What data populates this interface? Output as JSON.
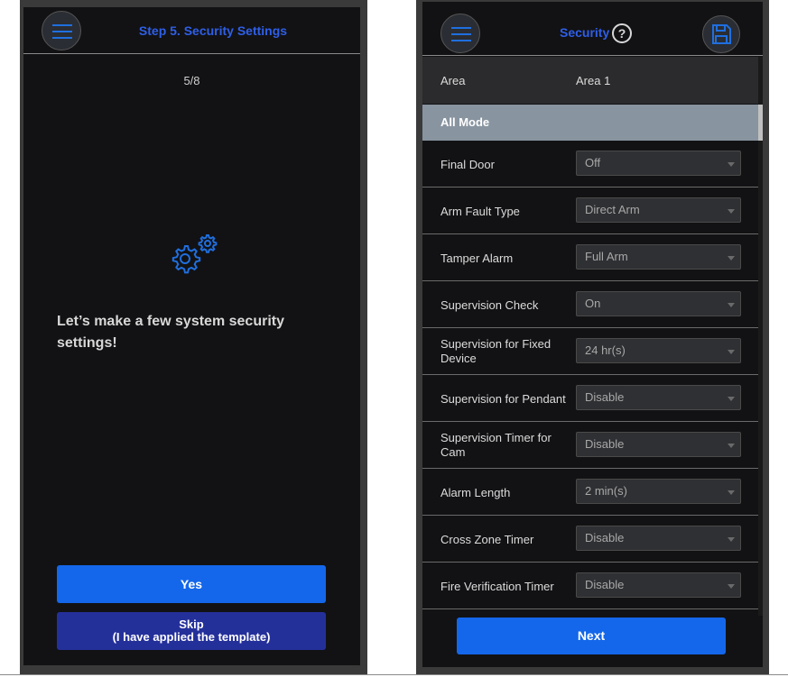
{
  "left": {
    "title": "Step 5. Security Settings",
    "step": "5/8",
    "intro": "Let’s make a few system security settings!",
    "yes_label": "Yes",
    "skip_label_1": "Skip",
    "skip_label_2": "(I have applied the template)",
    "menu_icon": "hamburger-menu-icon",
    "gear_icon": "gears-icon"
  },
  "right": {
    "title": "Security",
    "help_icon": "help-circle-icon",
    "save_icon": "save-floppy-icon",
    "area_label": "Area",
    "area_value": "Area 1",
    "mode_header": "All Mode",
    "settings": [
      {
        "label": "Final Door",
        "value": "Off"
      },
      {
        "label": "Arm Fault Type",
        "value": "Direct Arm"
      },
      {
        "label": "Tamper Alarm",
        "value": "Full Arm"
      },
      {
        "label": "Supervision Check",
        "value": "On"
      },
      {
        "label": "Supervision for Fixed Device",
        "value": "24 hr(s)"
      },
      {
        "label": "Supervision for Pendant",
        "value": "Disable"
      },
      {
        "label": "Supervision Timer for Cam",
        "value": "Disable"
      },
      {
        "label": "Alarm Length",
        "value": "2 min(s)"
      },
      {
        "label": "Cross Zone Timer",
        "value": "Disable"
      },
      {
        "label": "Fire Verification Timer",
        "value": "Disable"
      }
    ],
    "next_label": "Next"
  },
  "colors": {
    "accent_blue": "#1467ea",
    "title_blue": "#2f5fe8",
    "skip_blue": "#24309a",
    "mode_header_bg": "#8894a0",
    "screen_bg": "#121214"
  }
}
